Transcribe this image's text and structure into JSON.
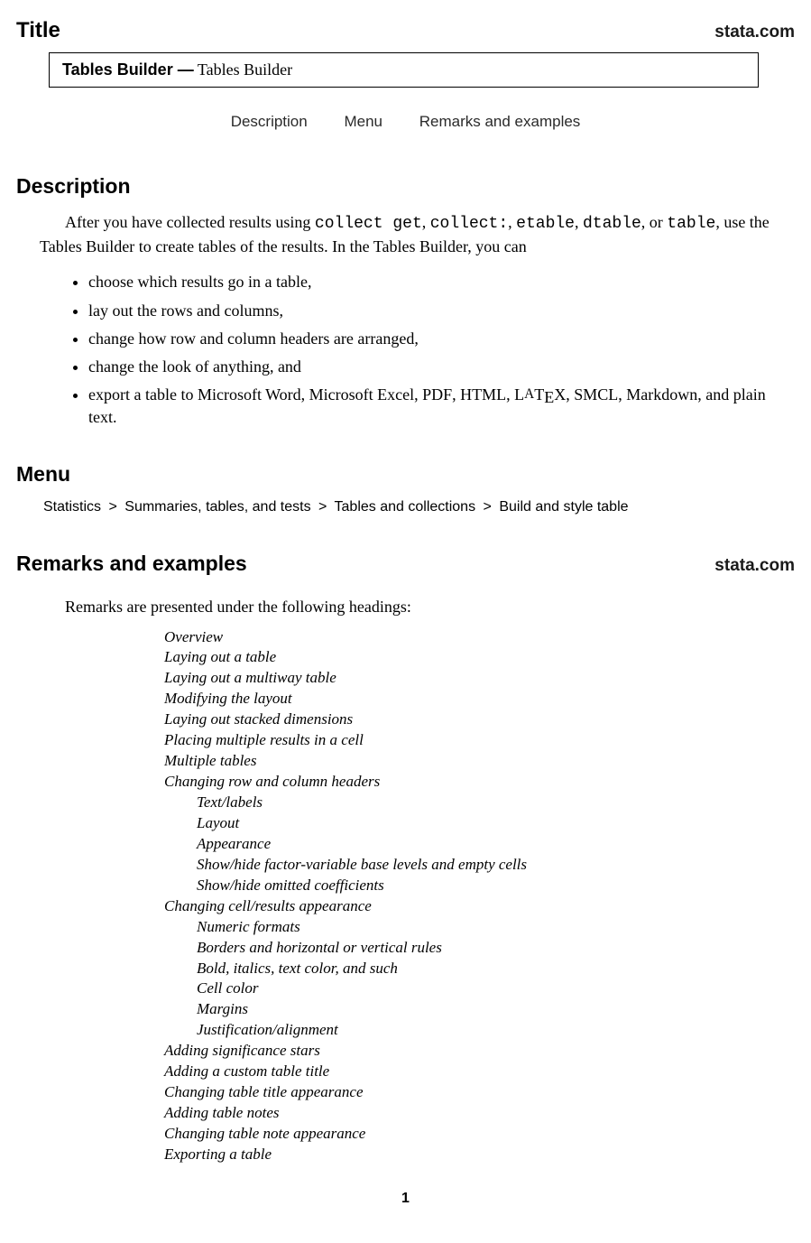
{
  "brand": "stata.com",
  "title_section": "Title",
  "title_box": {
    "bold": "Tables Builder —",
    "rest": " Tables Builder"
  },
  "nav": {
    "desc": "Description",
    "menu": "Menu",
    "rem": "Remarks and examples"
  },
  "description": {
    "heading": "Description",
    "para_pre": "After you have collected results using ",
    "cmds": [
      "collect get",
      "collect:",
      "etable",
      "dtable",
      "table"
    ],
    "para_mid": ", use the Tables Builder to create tables of the results. In the Tables Builder, you can",
    "bullets": [
      "choose which results go in a table,",
      "lay out the rows and columns,",
      "change how row and column headers are arranged,",
      "change the look of anything, and"
    ],
    "bullet_export_pre": "export a table to Microsoft Word, Microsoft Excel, ",
    "bullet_export_post": ", Markdown, and plain text."
  },
  "menu": {
    "heading": "Menu",
    "path": [
      "Statistics",
      "Summaries, tables, and tests",
      "Tables and collections",
      "Build and style table"
    ]
  },
  "remarks": {
    "heading": "Remarks and examples",
    "intro": "Remarks are presented under the following headings:",
    "toc": [
      {
        "t": "Overview"
      },
      {
        "t": "Laying out a table"
      },
      {
        "t": "Laying out a multiway table"
      },
      {
        "t": "Modifying the layout"
      },
      {
        "t": "Laying out stacked dimensions"
      },
      {
        "t": "Placing multiple results in a cell"
      },
      {
        "t": "Multiple tables"
      },
      {
        "t": "Changing row and column headers"
      },
      {
        "t": "Text/labels",
        "sub": true
      },
      {
        "t": "Layout",
        "sub": true
      },
      {
        "t": "Appearance",
        "sub": true
      },
      {
        "t": "Show/hide factor-variable base levels and empty cells",
        "sub": true
      },
      {
        "t": "Show/hide omitted coefficients",
        "sub": true
      },
      {
        "t": "Changing cell/results appearance"
      },
      {
        "t": "Numeric formats",
        "sub": true
      },
      {
        "t": "Borders and horizontal or vertical rules",
        "sub": true
      },
      {
        "t": "Bold, italics, text color, and such",
        "sub": true
      },
      {
        "t": "Cell color",
        "sub": true
      },
      {
        "t": "Margins",
        "sub": true
      },
      {
        "t": "Justification/alignment",
        "sub": true
      },
      {
        "t": "Adding significance stars"
      },
      {
        "t": "Adding a custom table title"
      },
      {
        "t": "Changing table title appearance"
      },
      {
        "t": "Adding table notes"
      },
      {
        "t": "Changing table note appearance"
      },
      {
        "t": "Exporting a table"
      }
    ]
  },
  "page": "1"
}
